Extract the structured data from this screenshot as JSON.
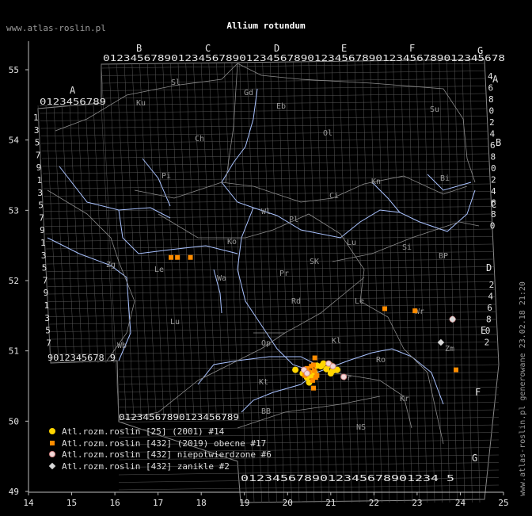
{
  "site_url": "www.atlas-roslin.pl",
  "title": "Allium rotundum",
  "stamp": "www.atlas-roslin.pl generowane 23.02.18 21:20",
  "axis": {
    "x_labels": [
      "14",
      "15",
      "16",
      "17",
      "18",
      "19",
      "20",
      "21",
      "22",
      "23",
      "24",
      "25"
    ],
    "y_labels": [
      "55",
      "54",
      "53",
      "52",
      "51",
      "50",
      "49"
    ]
  },
  "grid": {
    "top_columns": [
      "B",
      "C",
      "D",
      "E",
      "F",
      "G"
    ],
    "top_digits": "01234567890123456789012345678901234567890123456789012345678",
    "a_digits": "0123456789",
    "bottom_left_digits": "9012345678 9",
    "bottom_mid_digits": "01234567890123456789",
    "bottom_right_digits": "0123456789012345678901234 5",
    "left_letter": "A",
    "left_digits": [
      "1",
      "3",
      "5",
      "7",
      "9",
      "1",
      "3",
      "5",
      "7",
      "9",
      "1",
      "3",
      "5",
      "7",
      "9",
      "1",
      "3",
      "5",
      "7"
    ],
    "right_digits": [
      "4",
      "6",
      "8",
      "0",
      "2",
      "4",
      "6",
      "8",
      "0",
      "2",
      "4",
      "6",
      "8",
      "0",
      "2",
      "4",
      "6",
      "8",
      "0",
      "2"
    ],
    "right_letters": [
      "A",
      "B",
      "C",
      "D",
      "E",
      "F",
      "G"
    ]
  },
  "regions": [
    "Sl",
    "Ku",
    "Gd",
    "Eb",
    "Su",
    "Ch",
    "Ol",
    "Pi",
    "Bi",
    "Ci",
    "Kn",
    "Wl",
    "Pl",
    "Ko",
    "Si",
    "Zg",
    "Le",
    "Wa",
    "Lu",
    "BP",
    "SK",
    "Pr",
    "Rd",
    "Le",
    "Wr",
    "Lu",
    "Kl",
    "Op",
    "Zm",
    "Wb",
    "Kt",
    "Tr",
    "Ro",
    "BB",
    "NS",
    "Kr"
  ],
  "legend": [
    {
      "label": "Atl.rozm.roslin [25] (2001) #14"
    },
    {
      "label": "Atl.rozm.roslin [432] (2019) obecne #17"
    },
    {
      "label": "Atl.rozm.roslin [432] niepotwierdzone #6"
    },
    {
      "label": "Atl.rozm.roslin [432] zanikle #2"
    }
  ],
  "colors": {
    "yellow": "#ffd500",
    "orange": "#ff8c00",
    "pink": "#f1d9d9",
    "grey": "#d8d8d8",
    "river": "#a9c2ff",
    "grid": "#5a5a5a",
    "bg": "#000000"
  },
  "chart_data": {
    "type": "scatter",
    "xlim": [
      14,
      25
    ],
    "ylim": [
      49,
      55.5
    ],
    "series": [
      {
        "name": "Atl.rozm.roslin [25] (2001) #14",
        "marker": "circle",
        "color": "#ffd500",
        "points": [
          [
            20.18,
            50.73
          ],
          [
            20.35,
            50.68
          ],
          [
            20.45,
            50.62
          ],
          [
            20.5,
            50.55
          ],
          [
            20.68,
            50.79
          ],
          [
            20.83,
            50.82
          ],
          [
            20.98,
            50.8
          ],
          [
            20.9,
            50.74
          ],
          [
            21.05,
            50.72
          ],
          [
            21.15,
            50.73
          ],
          [
            20.55,
            50.65
          ],
          [
            20.62,
            50.7
          ],
          [
            20.77,
            50.78
          ],
          [
            21.0,
            50.68
          ]
        ]
      },
      {
        "name": "Atl.rozm.roslin [432] (2019) obecne #17",
        "marker": "square",
        "color": "#ff8c00",
        "points": [
          [
            17.3,
            52.33
          ],
          [
            17.45,
            52.33
          ],
          [
            17.75,
            52.33
          ],
          [
            20.6,
            50.47
          ],
          [
            20.63,
            50.9
          ],
          [
            20.65,
            50.62
          ],
          [
            20.45,
            50.75
          ],
          [
            20.6,
            50.8
          ],
          [
            20.68,
            50.65
          ],
          [
            20.4,
            50.65
          ],
          [
            22.25,
            51.6
          ],
          [
            22.95,
            51.57
          ],
          [
            23.9,
            50.73
          ],
          [
            20.5,
            50.7
          ],
          [
            20.58,
            50.58
          ],
          [
            20.62,
            50.72
          ],
          [
            20.55,
            50.78
          ]
        ]
      },
      {
        "name": "Atl.rozm.roslin [432] niepotwierdzone #6",
        "marker": "circle-outline",
        "color": "#f1d9d9",
        "points": [
          [
            20.38,
            50.73
          ],
          [
            20.45,
            50.68
          ],
          [
            20.95,
            50.82
          ],
          [
            21.05,
            50.78
          ],
          [
            23.82,
            51.45
          ],
          [
            21.3,
            50.63
          ]
        ]
      },
      {
        "name": "Atl.rozm.roslin [432] zanikle #2",
        "marker": "diamond",
        "color": "#d8d8d8",
        "points": [
          [
            23.55,
            51.12
          ],
          [
            23.82,
            51.45
          ]
        ]
      }
    ]
  }
}
